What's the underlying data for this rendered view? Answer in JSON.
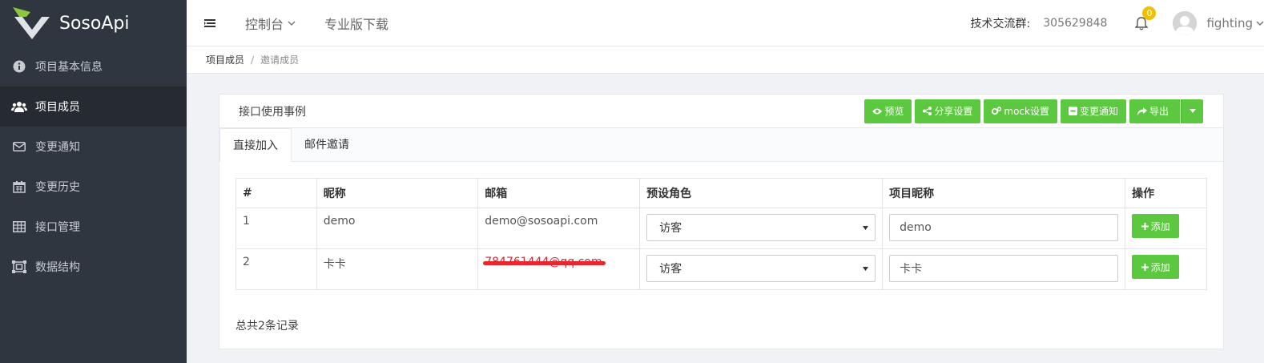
{
  "app": {
    "name": "SosoApi"
  },
  "sidebar": {
    "items": [
      {
        "label": "项目基本信息",
        "icon": "info-icon"
      },
      {
        "label": "项目成员",
        "icon": "users-icon",
        "active": true
      },
      {
        "label": "变更通知",
        "icon": "envelope-icon"
      },
      {
        "label": "变更历史",
        "icon": "calendar-icon"
      },
      {
        "label": "接口管理",
        "icon": "table-icon"
      },
      {
        "label": "数据结构",
        "icon": "structure-icon"
      }
    ]
  },
  "header": {
    "menu_console": "控制台",
    "menu_download": "专业版下载",
    "qq_label": "技术交流群:",
    "qq_number": "305629848",
    "notification_count": "0",
    "username": "fighting"
  },
  "breadcrumb": {
    "items": [
      "项目成员",
      "邀请成员"
    ],
    "separator": "/"
  },
  "panel": {
    "title": "接口使用事例",
    "buttons": {
      "preview": "预览",
      "share": "分享设置",
      "mock": "mock设置",
      "notify": "变更通知",
      "export": "导出"
    },
    "tabs": [
      "直接加入",
      "邮件邀请"
    ],
    "table": {
      "headers": [
        "#",
        "昵称",
        "邮箱",
        "预设角色",
        "项目昵称",
        "操作"
      ],
      "rows": [
        {
          "index": "1",
          "nickname": "demo",
          "email": "demo@sosoapi.com",
          "role": "访客",
          "project_nickname": "demo",
          "action": "添加"
        },
        {
          "index": "2",
          "nickname": "卡卡",
          "email": "784761444@qq.com",
          "role": "访客",
          "project_nickname": "卡卡",
          "action": "添加"
        }
      ]
    },
    "total": "总共2条记录"
  },
  "colors": {
    "sidebar_bg": "#2f3640",
    "accent_green": "#5cc83f",
    "badge_yellow": "#f0c000"
  }
}
